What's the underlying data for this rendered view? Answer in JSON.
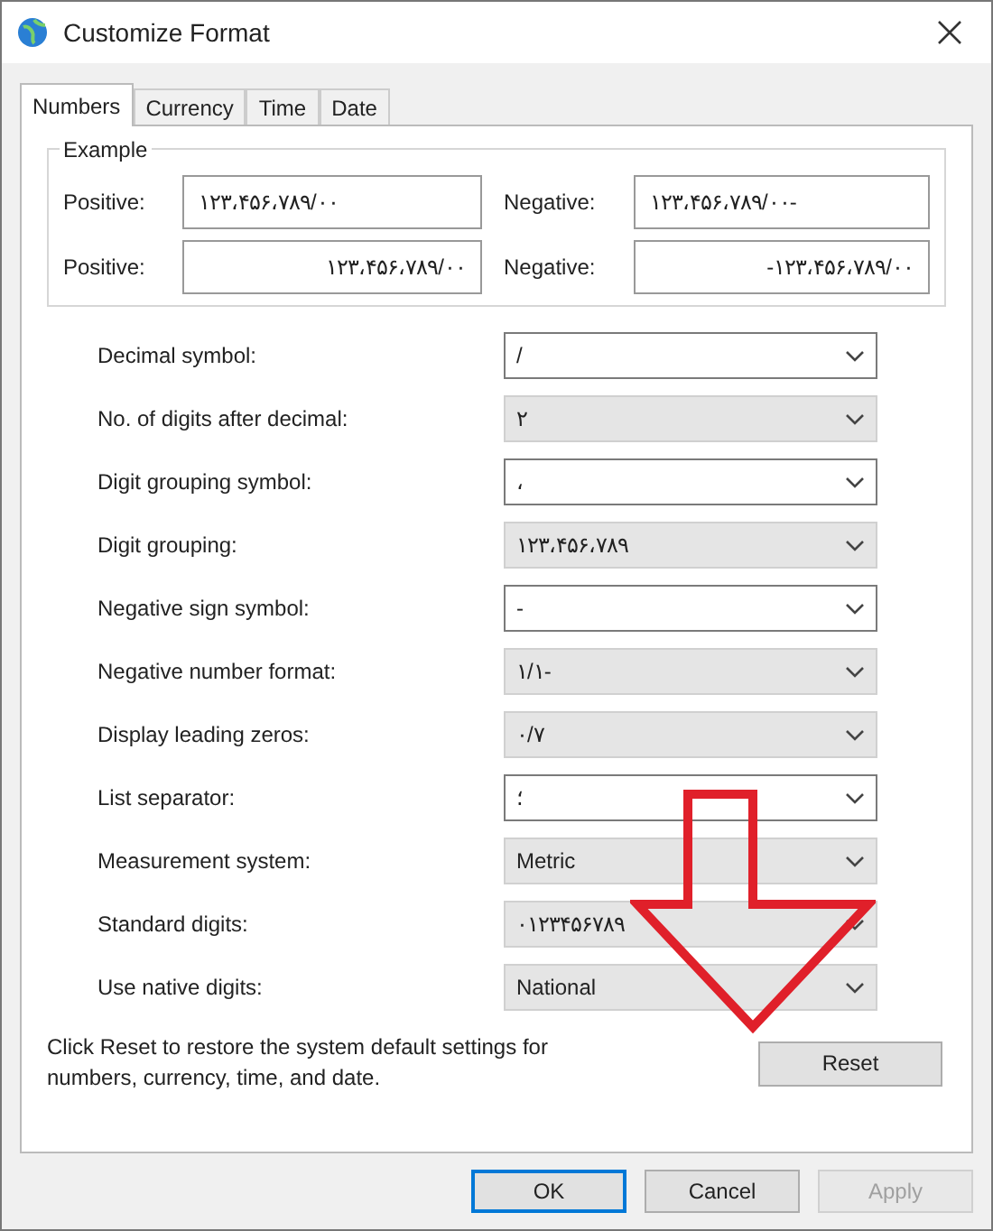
{
  "window": {
    "title": "Customize Format"
  },
  "tabs": [
    {
      "label": "Numbers",
      "selected": true
    },
    {
      "label": "Currency",
      "selected": false
    },
    {
      "label": "Time",
      "selected": false
    },
    {
      "label": "Date",
      "selected": false
    }
  ],
  "example": {
    "title": "Example",
    "rows": [
      {
        "positive_label": "Positive:",
        "positive": "۱۲۳،۴۵۶،۷۸۹/۰۰",
        "negative_label": "Negative:",
        "negative": "۱۲۳،۴۵۶،۷۸۹/۰۰-",
        "kind": "left"
      },
      {
        "positive_label": "Positive:",
        "positive": "۱۲۳،۴۵۶،۷۸۹/۰۰",
        "negative_label": "Negative:",
        "negative": "-۱۲۳،۴۵۶،۷۸۹/۰۰",
        "kind": "right"
      }
    ]
  },
  "settings": [
    {
      "label": "Decimal symbol:",
      "value": "/",
      "kind": "editable"
    },
    {
      "label": "No. of digits after decimal:",
      "value": "۲",
      "kind": "list"
    },
    {
      "label": "Digit grouping symbol:",
      "value": "،",
      "kind": "editable"
    },
    {
      "label": "Digit grouping:",
      "value": "۱۲۳،۴۵۶،۷۸۹",
      "kind": "list"
    },
    {
      "label": "Negative sign symbol:",
      "value": "-",
      "kind": "editable"
    },
    {
      "label": "Negative number format:",
      "value": "۱/۱-",
      "kind": "list"
    },
    {
      "label": "Display leading zeros:",
      "value": "۰/۷",
      "kind": "list"
    },
    {
      "label": "List separator:",
      "value": "؛",
      "kind": "editable"
    },
    {
      "label": "Measurement system:",
      "value": "Metric",
      "kind": "list"
    },
    {
      "label": "Standard digits:",
      "value": "۰۱۲۳۴۵۶۷۸۹",
      "kind": "list"
    },
    {
      "label": "Use native digits:",
      "value": "National",
      "kind": "list"
    }
  ],
  "reset_note": "Click Reset to restore the system default settings for numbers, currency, time, and date.",
  "reset_button": "Reset",
  "buttons": [
    {
      "label": "OK",
      "default": true,
      "disabled": false
    },
    {
      "label": "Cancel",
      "default": false,
      "disabled": false
    },
    {
      "label": "Apply",
      "default": false,
      "disabled": true
    }
  ]
}
